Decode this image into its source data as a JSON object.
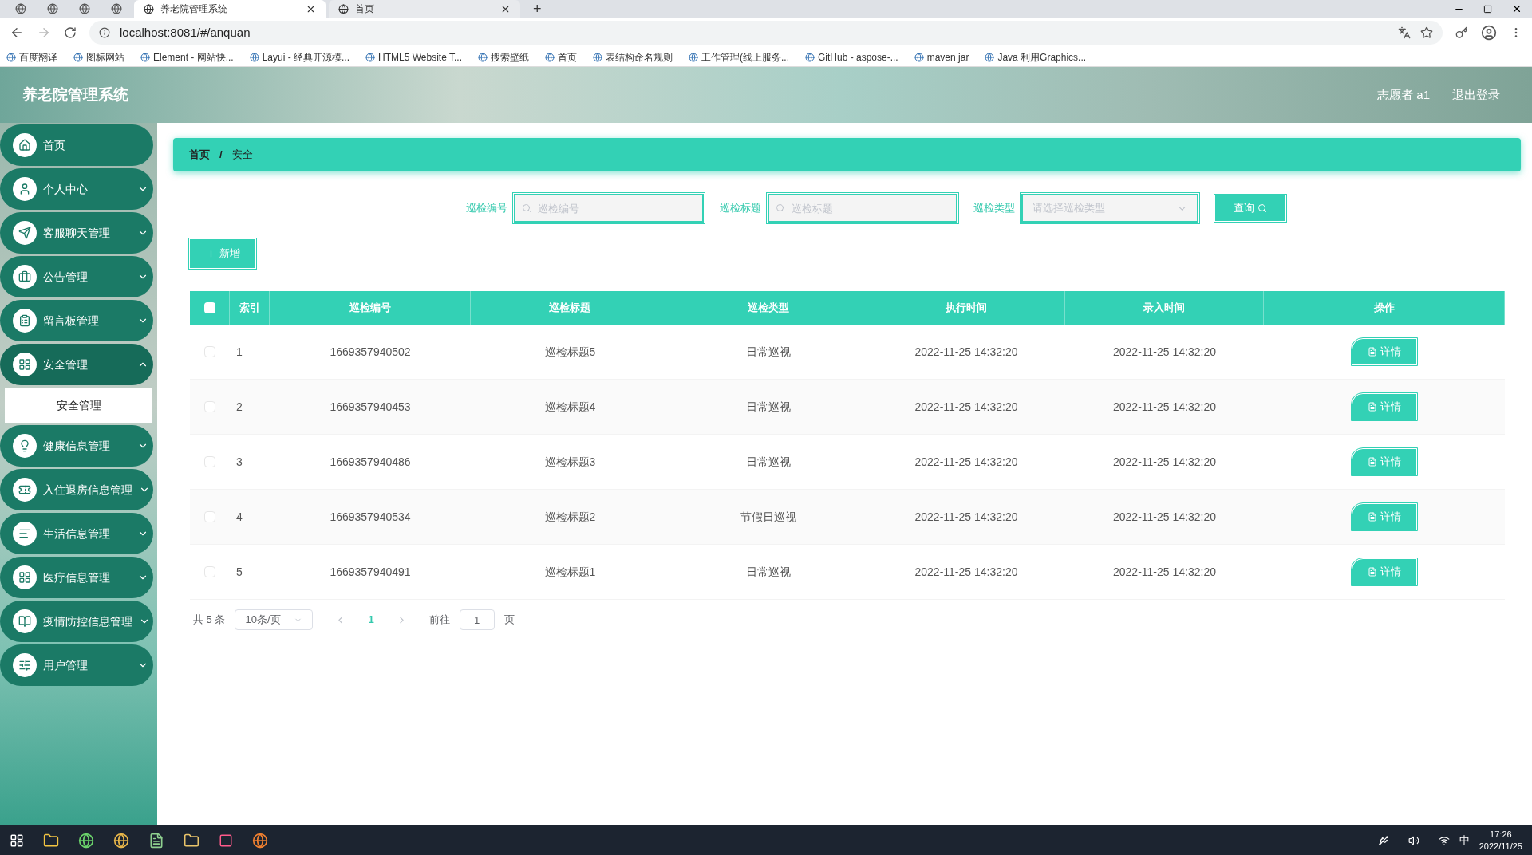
{
  "browser": {
    "tabs": [
      {
        "kind": "icon",
        "selected": false
      },
      {
        "kind": "icon",
        "selected": false
      },
      {
        "kind": "icon",
        "selected": false
      },
      {
        "kind": "icon",
        "selected": false
      },
      {
        "kind": "page",
        "label": "养老院管理系统",
        "selected": true
      },
      {
        "kind": "page",
        "label": "首页",
        "selected": false
      }
    ],
    "new_tab": "+",
    "url": "localhost:8081/#/anquan",
    "bookmarks": [
      "百度翻译",
      "图标网站",
      "Element - 网站快...",
      "Layui - 经典开源模...",
      "HTML5 Website T...",
      "搜索壁纸",
      "首页",
      "表结构命名规则",
      "工作管理(线上服务...",
      "GitHub - aspose-...",
      "maven jar",
      "Java 利用Graphics..."
    ]
  },
  "header": {
    "title": "养老院管理系统",
    "user": "志愿者 a1",
    "logout": "退出登录"
  },
  "sidebar": {
    "items": [
      {
        "kind": "link",
        "label": "首页"
      },
      {
        "kind": "menu",
        "label": "个人中心",
        "expanded": false
      },
      {
        "kind": "menu",
        "label": "客服聊天管理",
        "expanded": false
      },
      {
        "kind": "menu",
        "label": "公告管理",
        "expanded": false
      },
      {
        "kind": "menu",
        "label": "留言板管理",
        "expanded": false
      },
      {
        "kind": "menu",
        "label": "安全管理",
        "expanded": true,
        "children": [
          {
            "label": "安全管理",
            "selected": true
          }
        ]
      },
      {
        "kind": "menu",
        "label": "健康信息管理",
        "expanded": false
      },
      {
        "kind": "menu",
        "label": "入住退房信息管理",
        "expanded": false
      },
      {
        "kind": "menu",
        "label": "生活信息管理",
        "expanded": false
      },
      {
        "kind": "menu",
        "label": "医疗信息管理",
        "expanded": false
      },
      {
        "kind": "menu",
        "label": "疫情防控信息管理",
        "expanded": false
      },
      {
        "kind": "menu",
        "label": "用户管理",
        "expanded": false
      }
    ]
  },
  "breadcrumb": [
    "首页",
    "安全"
  ],
  "breadcrumb_separator": "/",
  "search": {
    "fields": [
      {
        "kind": "input",
        "label": "巡检编号",
        "placeholder": "巡检编号"
      },
      {
        "kind": "input",
        "label": "巡检标题",
        "placeholder": "巡检标题"
      },
      {
        "kind": "select",
        "label": "巡检类型",
        "placeholder": "请选择巡检类型"
      }
    ],
    "button": "查询"
  },
  "add_button": "新增",
  "table": {
    "columns": [
      "索引",
      "巡检编号",
      "巡检标题",
      "巡检类型",
      "执行时间",
      "录入时间",
      "操作"
    ],
    "all_checked": false,
    "rows": [
      {
        "checked": false,
        "cells": [
          "1",
          "1669357940502",
          "巡检标题5",
          "日常巡视",
          "2022-11-25 14:32:20",
          "2022-11-25 14:32:20"
        ],
        "action": "详情"
      },
      {
        "checked": false,
        "cells": [
          "2",
          "1669357940453",
          "巡检标题4",
          "日常巡视",
          "2022-11-25 14:32:20",
          "2022-11-25 14:32:20"
        ],
        "action": "详情"
      },
      {
        "checked": false,
        "cells": [
          "3",
          "1669357940486",
          "巡检标题3",
          "日常巡视",
          "2022-11-25 14:32:20",
          "2022-11-25 14:32:20"
        ],
        "action": "详情"
      },
      {
        "checked": false,
        "cells": [
          "4",
          "1669357940534",
          "巡检标题2",
          "节假日巡视",
          "2022-11-25 14:32:20",
          "2022-11-25 14:32:20"
        ],
        "action": "详情"
      },
      {
        "checked": false,
        "cells": [
          "5",
          "1669357940491",
          "巡检标题1",
          "日常巡视",
          "2022-11-25 14:32:20",
          "2022-11-25 14:32:20"
        ],
        "action": "详情"
      }
    ]
  },
  "pagination": {
    "total": "共 5 条",
    "page_size": "10条/页",
    "pages": [
      {
        "label": "1",
        "selected": true
      }
    ],
    "goto_label": "前往",
    "goto_value": "1",
    "goto_unit": "页"
  },
  "taskbar": {
    "time": "17:26",
    "date": "2022/11/25",
    "ime": "中"
  }
}
